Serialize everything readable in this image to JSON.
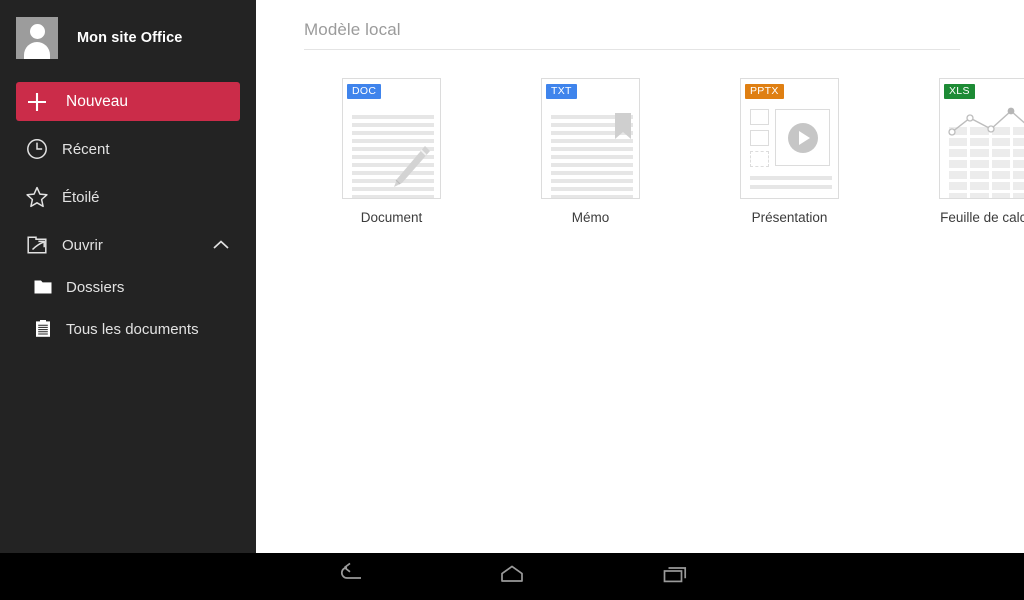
{
  "sidebar": {
    "account": {
      "name": "Mon site Office",
      "avatar_icon": "person-avatar-icon"
    },
    "primary_action": {
      "label": "Nouveau",
      "icon": "plus-icon",
      "color": "#cb2c49"
    },
    "items": [
      {
        "label": "Récent",
        "icon": "clock-icon"
      },
      {
        "label": "Étoilé",
        "icon": "star-outline-icon"
      },
      {
        "label": "Ouvrir",
        "icon": "open-folder-arrow-icon",
        "expander_icon": "chevron-up-icon",
        "expanded": true
      },
      {
        "label": "Dossiers",
        "icon": "folder-icon",
        "sub": true
      },
      {
        "label": "Tous les documents",
        "icon": "clipboard-list-icon",
        "sub": true
      }
    ],
    "background": "#232323"
  },
  "content": {
    "section_title": "Modèle local",
    "templates": [
      {
        "label": "Document",
        "badge": "DOC",
        "badge_color": "#3f84ec",
        "art": "lined-page-with-pen"
      },
      {
        "label": "Mémo",
        "badge": "TXT",
        "badge_color": "#3f84ec",
        "art": "lined-page-with-bookmark"
      },
      {
        "label": "Présentation",
        "badge": "PPTX",
        "badge_color": "#df7f12",
        "art": "slide-with-play-button"
      },
      {
        "label": "Feuille de calcul",
        "badge": "XLS",
        "badge_color": "#1d8b35",
        "art": "spreadsheet-with-line-chart"
      }
    ]
  },
  "system_nav": {
    "buttons": [
      {
        "name": "back",
        "icon": "back-arrow-icon"
      },
      {
        "name": "home",
        "icon": "home-outline-icon"
      },
      {
        "name": "recents",
        "icon": "recent-apps-icon"
      }
    ]
  }
}
